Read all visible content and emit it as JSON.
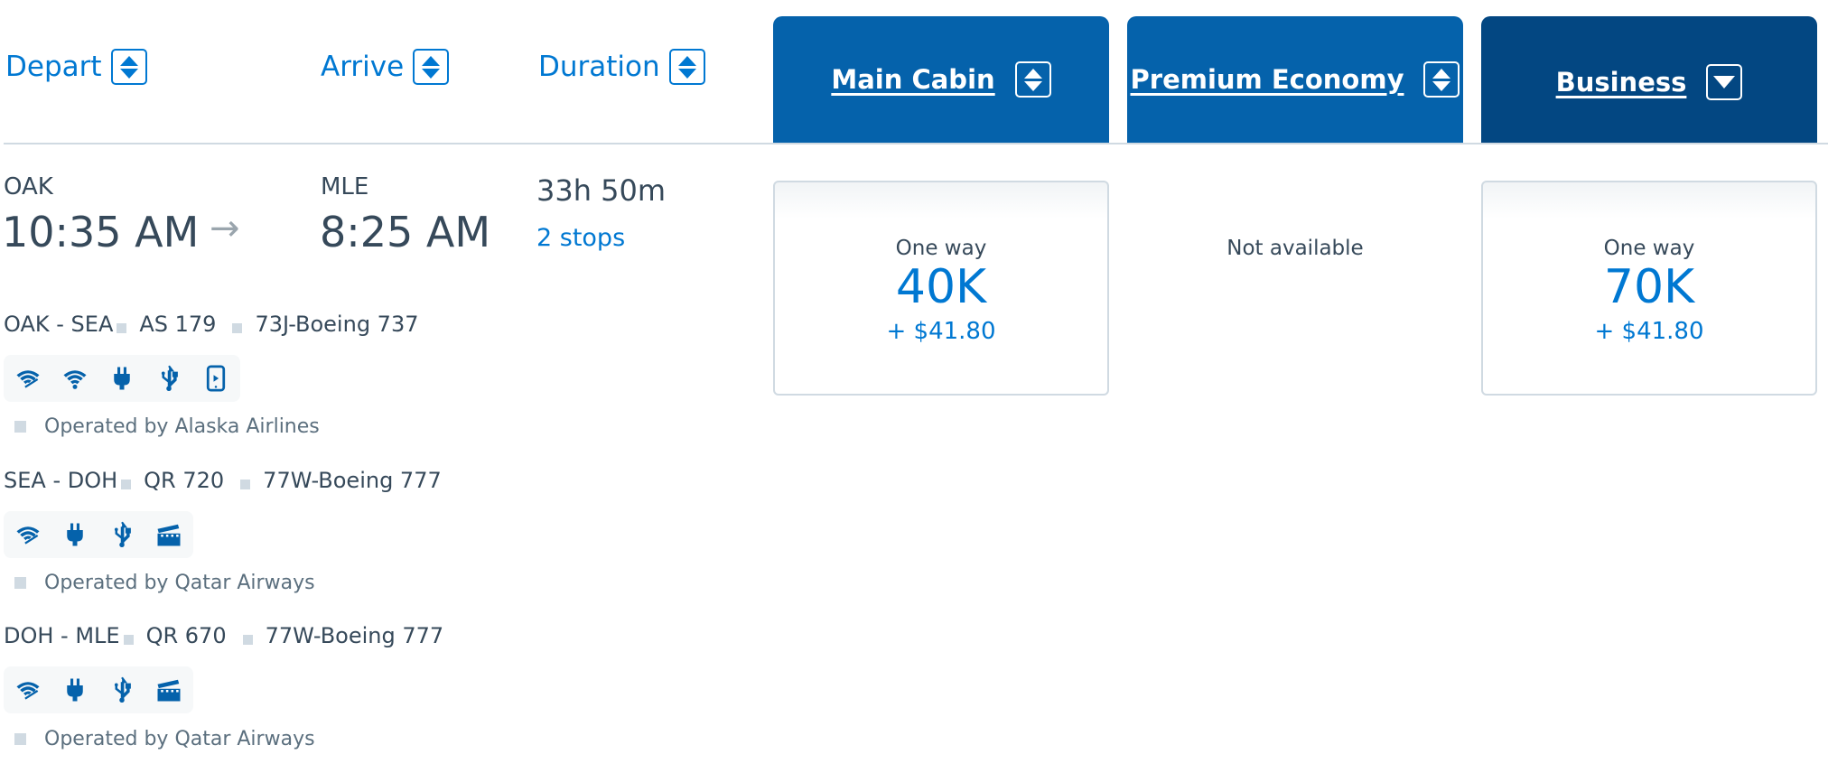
{
  "header": {
    "sort_columns": [
      {
        "label": "Depart"
      },
      {
        "label": "Arrive"
      },
      {
        "label": "Duration"
      }
    ],
    "cabins": [
      {
        "label": "Main Cabin",
        "sort": "both",
        "active": false
      },
      {
        "label": "Premium Economy",
        "sort": "both",
        "active": false
      },
      {
        "label": "Business",
        "sort": "descending",
        "active": true
      }
    ]
  },
  "colors": {
    "accent": "#0078d2",
    "cabin_header": "#0562ab",
    "cabin_header_active": "#034782",
    "text": "#36495a",
    "divider": "#d0dae2"
  },
  "flight": {
    "origin": "OAK",
    "depart_time": "10:35 AM",
    "arrow": "→",
    "destination": "MLE",
    "arrive_time": "8:25 AM",
    "duration": "33h 50m",
    "stops": "2 stops",
    "fares": [
      {
        "cabin": "Main Cabin",
        "available": true,
        "label": "One way",
        "miles": "40K",
        "tax": "+ $41.80"
      },
      {
        "cabin": "Premium Economy",
        "available": false,
        "label": "Not available"
      },
      {
        "cabin": "Business",
        "available": true,
        "label": "One way",
        "miles": "70K",
        "tax": "+ $41.80"
      }
    ],
    "segments": [
      {
        "route": "OAK - SEA",
        "flight_number": "AS 179",
        "aircraft": "73J-Boeing 737",
        "amenities": [
          "wifi-satellite-icon",
          "wifi-icon",
          "power-plug-icon",
          "usb-icon",
          "mobile-entertainment-icon"
        ],
        "operated_by": "Operated by Alaska Airlines"
      },
      {
        "route": "SEA - DOH",
        "flight_number": "QR 720",
        "aircraft": "77W-Boeing 777",
        "amenities": [
          "wifi-satellite-icon",
          "power-plug-icon",
          "usb-icon",
          "seatback-entertainment-icon"
        ],
        "operated_by": "Operated by Qatar Airways"
      },
      {
        "route": "DOH - MLE",
        "flight_number": "QR 670",
        "aircraft": "77W-Boeing 777",
        "amenities": [
          "wifi-satellite-icon",
          "power-plug-icon",
          "usb-icon",
          "seatback-entertainment-icon"
        ],
        "operated_by": "Operated by Qatar Airways"
      }
    ]
  }
}
